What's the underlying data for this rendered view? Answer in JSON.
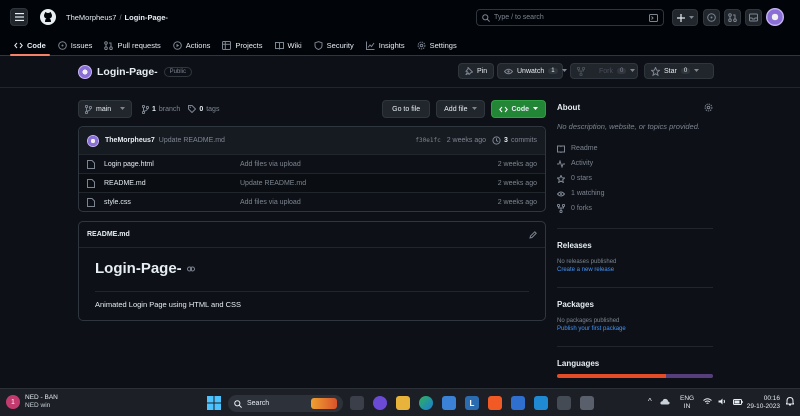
{
  "header": {
    "owner": "TheMorpheus7",
    "slash": "/",
    "repo": "Login-Page-",
    "search_placeholder": "Type / to search",
    "tabs": [
      {
        "label": "Code"
      },
      {
        "label": "Issues"
      },
      {
        "label": "Pull requests"
      },
      {
        "label": "Actions"
      },
      {
        "label": "Projects"
      },
      {
        "label": "Wiki"
      },
      {
        "label": "Security"
      },
      {
        "label": "Insights"
      },
      {
        "label": "Settings"
      }
    ]
  },
  "repo": {
    "name": "Login-Page-",
    "visibility": "Public",
    "pin_label": "Pin",
    "unwatch_label": "Unwatch",
    "unwatch_count": "1",
    "fork_label": "Fork",
    "fork_count": "0",
    "star_label": "Star",
    "star_count": "0"
  },
  "toolbar": {
    "branch": "main",
    "branch_count": "1",
    "branch_word": "branch",
    "tag_count": "0",
    "tag_word": "tags",
    "goto_file": "Go to file",
    "add_file": "Add file",
    "code": "Code"
  },
  "commit": {
    "author": "TheMorpheus7",
    "message": "Update README.md",
    "sha": "f30e1fc",
    "time": "2 weeks ago",
    "count": "3",
    "count_word": "commits"
  },
  "files": [
    {
      "name": "Login page.html",
      "message": "Add files via upload",
      "time": "2 weeks ago"
    },
    {
      "name": "README.md",
      "message": "Update README.md",
      "time": "2 weeks ago"
    },
    {
      "name": "style.css",
      "message": "Add files via upload",
      "time": "2 weeks ago"
    }
  ],
  "readme": {
    "file": "README.md",
    "title": "Login-Page-",
    "body": "Animated Login Page using HTML and CSS"
  },
  "about": {
    "title": "About",
    "description": "No description, website, or topics provided.",
    "items": [
      {
        "label": "Readme"
      },
      {
        "label": "Activity"
      },
      {
        "label": "0 stars"
      },
      {
        "label": "1 watching"
      },
      {
        "label": "0 forks"
      }
    ]
  },
  "releases": {
    "title": "Releases",
    "empty": "No releases published",
    "link": "Create a new release"
  },
  "packages": {
    "title": "Packages",
    "empty": "No packages published",
    "link": "Publish your first package"
  },
  "languages": {
    "title": "Languages"
  },
  "taskbar": {
    "weather_badge": "1",
    "weather_title": "NED - BAN",
    "weather_sub": "NED win",
    "search": "Search",
    "lang": "ENG",
    "region": "IN",
    "time": "00:16",
    "date": "29-10-2023"
  },
  "colors": {
    "accent_green": "#238636",
    "link_blue": "#4493f8",
    "tab_underline": "#f78166"
  }
}
